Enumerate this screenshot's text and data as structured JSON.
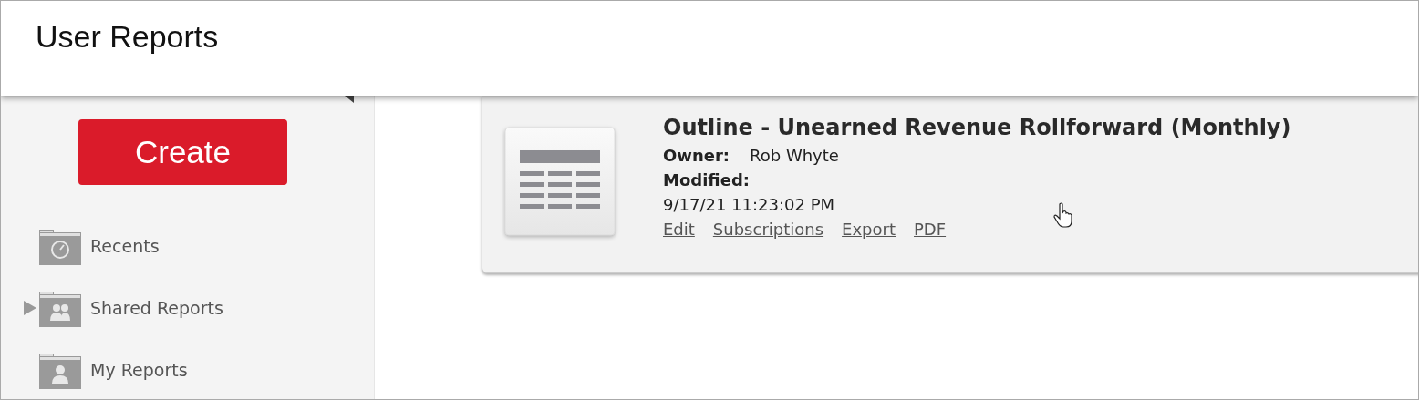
{
  "header": {
    "title": "User Reports"
  },
  "sidebar": {
    "create_button": "Create",
    "items": [
      {
        "kind": "recent",
        "label": "Recents"
      },
      {
        "kind": "shared",
        "label": "Shared Reports",
        "expanded": false
      },
      {
        "kind": "mine",
        "label": "My Reports"
      }
    ]
  },
  "report": {
    "title": "Outline - Unearned Revenue Rollforward (Monthly)",
    "owner_label": "Owner:",
    "owner": "Rob Whyte",
    "modified_label": "Modified:",
    "modified": "9/17/21 11:23:02 PM",
    "actions": [
      "Edit",
      "Subscriptions",
      "Export",
      "PDF"
    ]
  }
}
